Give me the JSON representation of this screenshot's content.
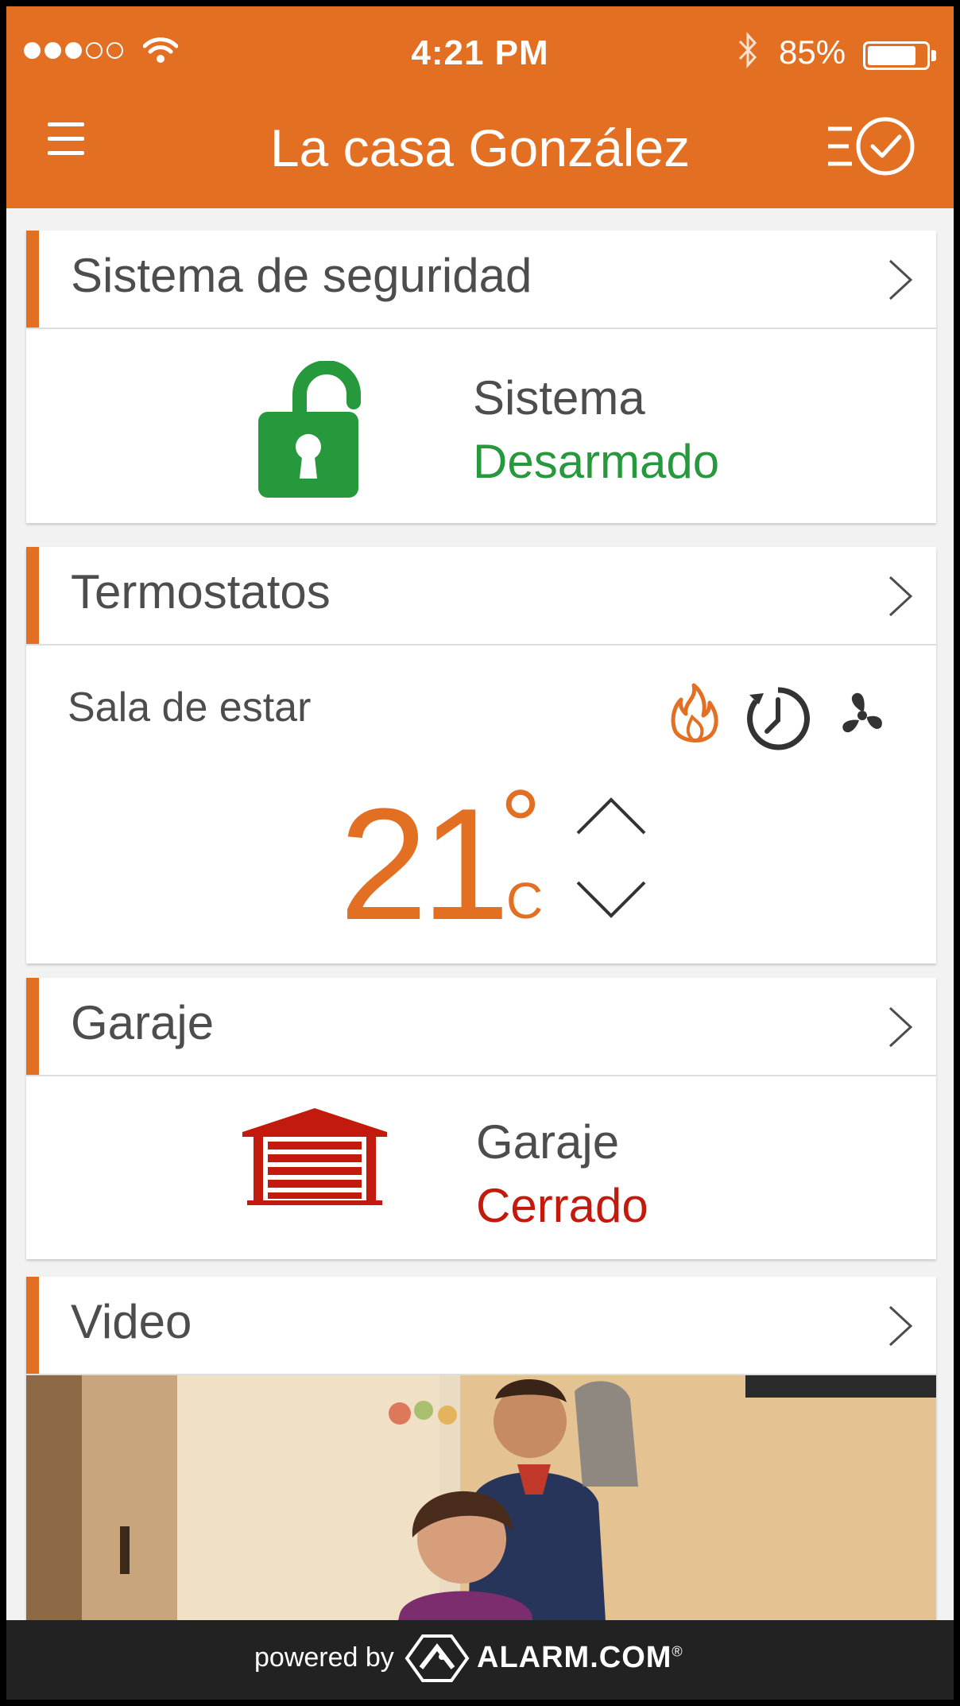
{
  "status_bar": {
    "time": "4:21 PM",
    "battery_percent": "85%",
    "battery_level": 0.85,
    "signal_bars_filled": 3,
    "signal_bars_total": 5
  },
  "header": {
    "title": "La casa González",
    "menu_icon": "hamburger-menu-icon",
    "history_icon": "list-check-icon"
  },
  "security": {
    "title": "Sistema de seguridad",
    "label": "Sistema",
    "status": "Desarmado",
    "status_color": "#25993c",
    "icon": "unlocked-padlock-icon"
  },
  "thermostats": {
    "title": "Termostatos",
    "room": "Sala de estar",
    "temperature": "21",
    "degree_symbol": "°",
    "unit": "C",
    "mode_icons": [
      "flame-heat-icon",
      "schedule-clock-icon",
      "fan-icon"
    ]
  },
  "garage": {
    "title": "Garaje",
    "label": "Garaje",
    "status": "Cerrado",
    "status_color": "#c21a0c",
    "icon": "garage-door-icon"
  },
  "video": {
    "title": "Video"
  },
  "footer": {
    "powered_by": "powered by",
    "brand": "ALARM.COM",
    "trademark": "®"
  },
  "colors": {
    "accent": "#e36f22",
    "armed_ok": "#25993c",
    "closed_red": "#c21a0c"
  }
}
